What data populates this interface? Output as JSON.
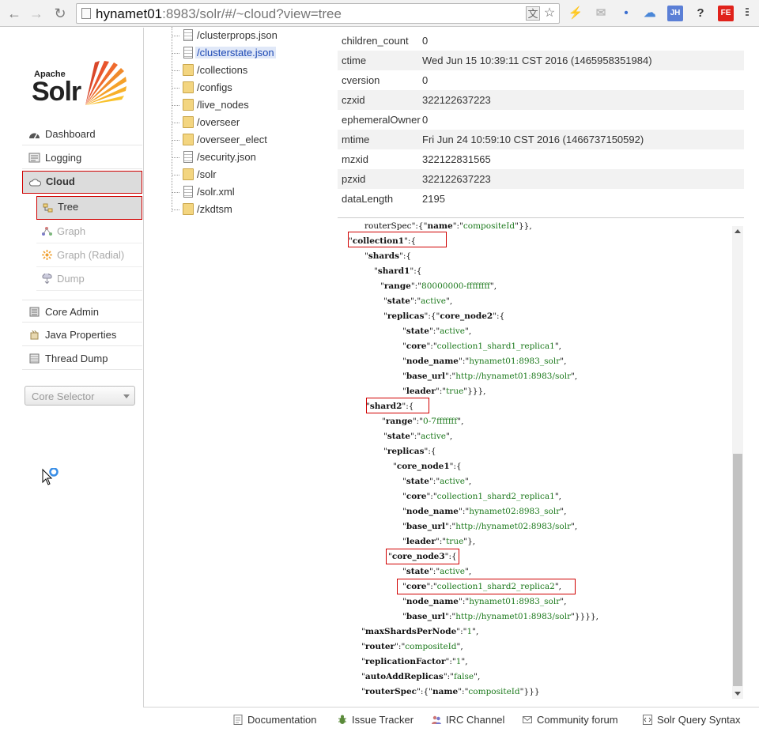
{
  "browser": {
    "url_host": "hynamet01",
    "url_rest": ":8983/solr/#/~cloud?view=tree",
    "back_icon": "back-arrow-icon",
    "forward_icon": "forward-arrow-icon",
    "reload_icon": "reload-icon",
    "extensions": [
      {
        "name": "extension-bolt-icon",
        "text": "⚡",
        "color": "#bbbbbb"
      },
      {
        "name": "extension-mail-icon",
        "text": "✉",
        "color": "#bbbbbb"
      },
      {
        "name": "extension-dots-icon",
        "text": "•",
        "color": "#3b6fd0"
      },
      {
        "name": "extension-cloud-icon",
        "text": "☁",
        "color": "#4a87d8"
      },
      {
        "name": "extension-jh-icon",
        "text": "JH",
        "color": "#5b7fd6"
      },
      {
        "name": "extension-unknown-icon",
        "text": "?",
        "color": "#333333"
      },
      {
        "name": "extension-fe-icon",
        "text": "FE",
        "color": "#e0221b"
      },
      {
        "name": "extension-cookie-icon",
        "text": "●",
        "color": "#c58a3a"
      }
    ]
  },
  "logo": {
    "apache": "Apache",
    "solr": "Solr"
  },
  "menu": {
    "dashboard": "Dashboard",
    "logging": "Logging",
    "cloud": "Cloud",
    "tree": "Tree",
    "graph": "Graph",
    "graph_radial": "Graph (Radial)",
    "dump": "Dump",
    "core_admin": "Core Admin",
    "java_properties": "Java Properties",
    "thread_dump": "Thread Dump",
    "core_selector": "Core Selector"
  },
  "tree": [
    {
      "name": "/clusterprops.json",
      "type": "file"
    },
    {
      "name": "/clusterstate.json",
      "type": "file",
      "selected": true
    },
    {
      "name": "/collections",
      "type": "folder"
    },
    {
      "name": "/configs",
      "type": "folder"
    },
    {
      "name": "/live_nodes",
      "type": "folder"
    },
    {
      "name": "/overseer",
      "type": "folder"
    },
    {
      "name": "/overseer_elect",
      "type": "folder"
    },
    {
      "name": "/security.json",
      "type": "file"
    },
    {
      "name": "/solr",
      "type": "folder"
    },
    {
      "name": "/solr.xml",
      "type": "file"
    },
    {
      "name": "/zkdtsm",
      "type": "folder"
    }
  ],
  "props": [
    {
      "k": "children_count",
      "v": "0"
    },
    {
      "k": "ctime",
      "v": "Wed Jun 15 10:39:11 CST 2016 (1465958351984)"
    },
    {
      "k": "cversion",
      "v": "0"
    },
    {
      "k": "czxid",
      "v": "322122637223"
    },
    {
      "k": "ephemeralOwner",
      "v": "0"
    },
    {
      "k": "mtime",
      "v": "Fri Jun 24 10:59:10 CST 2016 (1466737150592)"
    },
    {
      "k": "mzxid",
      "v": "322122831565"
    },
    {
      "k": "pzxid",
      "v": "322122637223"
    },
    {
      "k": "dataLength",
      "v": "2195"
    }
  ],
  "json_lines": [
    "  routerSpec\":{\"name\":\"compositeId\"}},",
    "\"collection1\":{",
    "  \"shards\":{",
    "    \"shard1\":{",
    "      \"range\":\"80000000-ffffffff\",",
    "      \"state\":\"active\",",
    "      \"replicas\":{\"core_node2\":{",
    "          \"state\":\"active\",",
    "          \"core\":\"collection1_shard1_replica1\",",
    "          \"node_name\":\"hynamet01:8983_solr\",",
    "          \"base_url\":\"http://hynamet01:8983/solr\",",
    "          \"leader\":\"true\"}}},",
    "    \"shard2\":{",
    "      \"range\":\"0-7fffffff\",",
    "      \"state\":\"active\",",
    "      \"replicas\":{",
    "        \"core_node1\":{",
    "          \"state\":\"active\",",
    "          \"core\":\"collection1_shard2_replica1\",",
    "          \"node_name\":\"hynamet02:8983_solr\",",
    "          \"base_url\":\"http://hynamet02:8983/solr\",",
    "          \"leader\":\"true\"},",
    "        \"core_node3\":{",
    "          \"state\":\"active\",",
    "          \"core\":\"collection1_shard2_replica2\",",
    "          \"node_name\":\"hynamet01:8983_solr\",",
    "          \"base_url\":\"http://hynamet01:8983/solr\"}}}},",
    "  \"maxShardsPerNode\":\"1\",",
    "  \"router\":\"compositeId\",",
    "  \"replicationFactor\":\"1\",",
    "  \"autoAddReplicas\":\"false\",",
    "  \"routerSpec\":{\"name\":\"compositeId\"}}}"
  ],
  "footer": {
    "documentation": "Documentation",
    "issue_tracker": "Issue Tracker",
    "irc_channel": "IRC Channel",
    "community_forum": "Community forum",
    "query_syntax": "Solr Query Syntax"
  }
}
